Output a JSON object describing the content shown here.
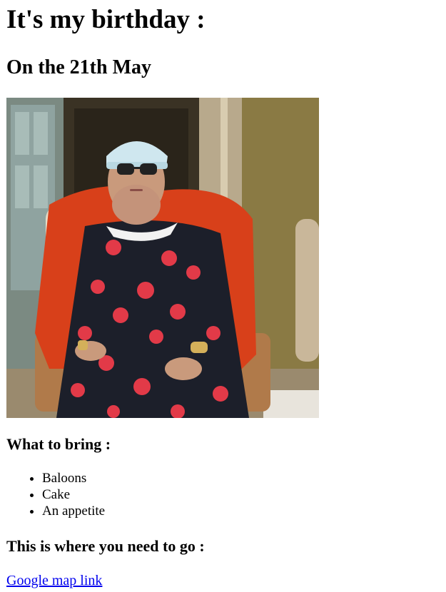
{
  "page": {
    "heading": "It's my birthday :",
    "date_heading": "On the 21th May",
    "photo": {
      "description_icon": "person-photo"
    },
    "bring_heading": "What to bring :",
    "bring_items": [
      "Baloons",
      "Cake",
      "An appetite"
    ],
    "location_heading": "This is where you need to go :",
    "map_link_label": "Google map link"
  },
  "colors": {
    "link": "#0000ee",
    "text": "#000000",
    "background": "#ffffff"
  }
}
